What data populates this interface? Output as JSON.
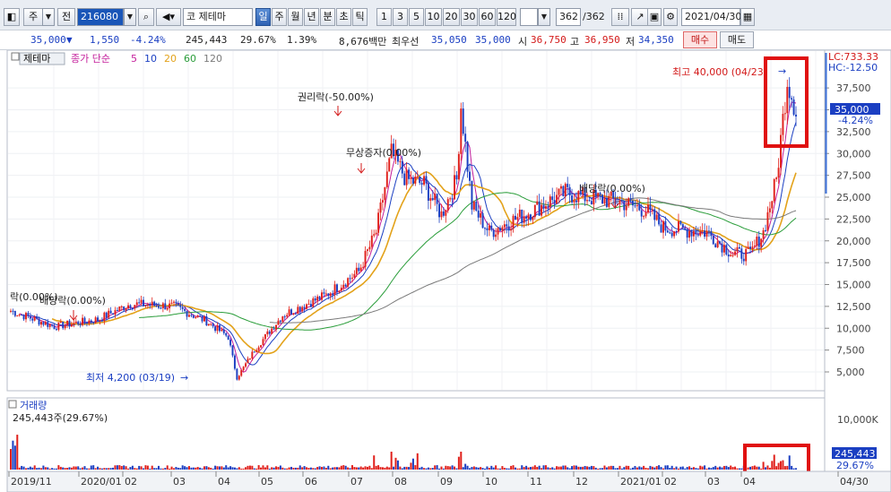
{
  "toolbar": {
    "market": "주",
    "prev_label": "전",
    "code": "216080",
    "stock_name": "코 제테마",
    "periods": [
      {
        "label": "일",
        "selected": true
      },
      {
        "label": "주",
        "selected": false
      },
      {
        "label": "월",
        "selected": false
      },
      {
        "label": "년",
        "selected": false
      },
      {
        "label": "분",
        "selected": false
      },
      {
        "label": "초",
        "selected": false
      },
      {
        "label": "틱",
        "selected": false
      }
    ],
    "intervals": [
      "1",
      "3",
      "5",
      "10",
      "20",
      "30",
      "60",
      "120"
    ],
    "count": "362",
    "count_total": "/362",
    "date": "2021/04/30"
  },
  "quote": {
    "price": "35,000",
    "change": "1,550",
    "change_rate": "-4.24%",
    "volume": "245,443",
    "volume_ratio": "29.67%",
    "turnover": "1.39%",
    "amount": "8,676백만",
    "best_ask_label": "최우선",
    "best_ask": "35,050",
    "best_bid": "35,000",
    "open_label": "시",
    "open": "36,750",
    "high_label": "고",
    "high": "36,950",
    "low_label": "저",
    "low": "34,350",
    "buy_label": "매수",
    "sell_label": "매도"
  },
  "legend": {
    "name": "제테마",
    "ma_title": "종가 단순",
    "ma": [
      {
        "label": "5",
        "color": "#c41e9b"
      },
      {
        "label": "10",
        "color": "#1b3fc2"
      },
      {
        "label": "20",
        "color": "#e3a21a"
      },
      {
        "label": "60",
        "color": "#2a9d3a"
      },
      {
        "label": "120",
        "color": "#7a7a7a"
      }
    ]
  },
  "right_axis": {
    "lc": "LC:733.33",
    "hc": "HC:-12.50",
    "price_tag": "35,000",
    "rate_tag": "-4.24%",
    "ticks": [
      "37,500",
      "35,000",
      "32,500",
      "30,000",
      "27,500",
      "25,000",
      "22,500",
      "20,000",
      "17,500",
      "15,000",
      "12,500",
      "10,000",
      "7,500",
      "5,000"
    ],
    "vol_tick": "10,000K",
    "vol_tag": "245,443",
    "vol_rate": "29.67%"
  },
  "annotations": {
    "high": "최고 40,000 (04/23)",
    "low": "최저 4,200 (03/19)",
    "rights": "권리락(-50.00%)",
    "bonus": "무상증자(0.00%)",
    "div1": "배당락(0.00%)",
    "div2": "배당락(0.00%)",
    "div0": "락(0.00%)"
  },
  "volume_panel": {
    "title": "거래량",
    "value": "245,443주(29.67%)"
  },
  "x_axis": [
    "2019/11",
    "2020/01",
    "02",
    "03",
    "04",
    "05",
    "06",
    "07",
    "08",
    "09",
    "10",
    "11",
    "12",
    "2021/01",
    "02",
    "03",
    "04",
    "04/30"
  ],
  "colors": {
    "up": "#e0201b",
    "down": "#1b3fc2",
    "highlight": "#e01010"
  }
}
